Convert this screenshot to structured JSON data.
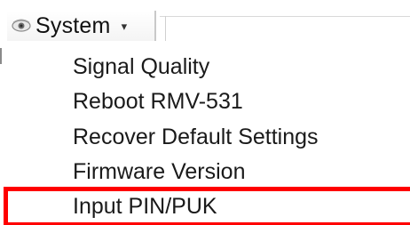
{
  "menu": {
    "title": "System",
    "icon": "eye-icon",
    "caret": "▾"
  },
  "dropdown": {
    "items": [
      {
        "label": "Signal Quality"
      },
      {
        "label": "Reboot RMV-531"
      },
      {
        "label": "Recover Default Settings"
      },
      {
        "label": "Firmware Version"
      },
      {
        "label": "Input PIN/PUK"
      }
    ]
  },
  "highlight": {
    "target": "Input PIN/PUK",
    "color": "#ff0000"
  }
}
